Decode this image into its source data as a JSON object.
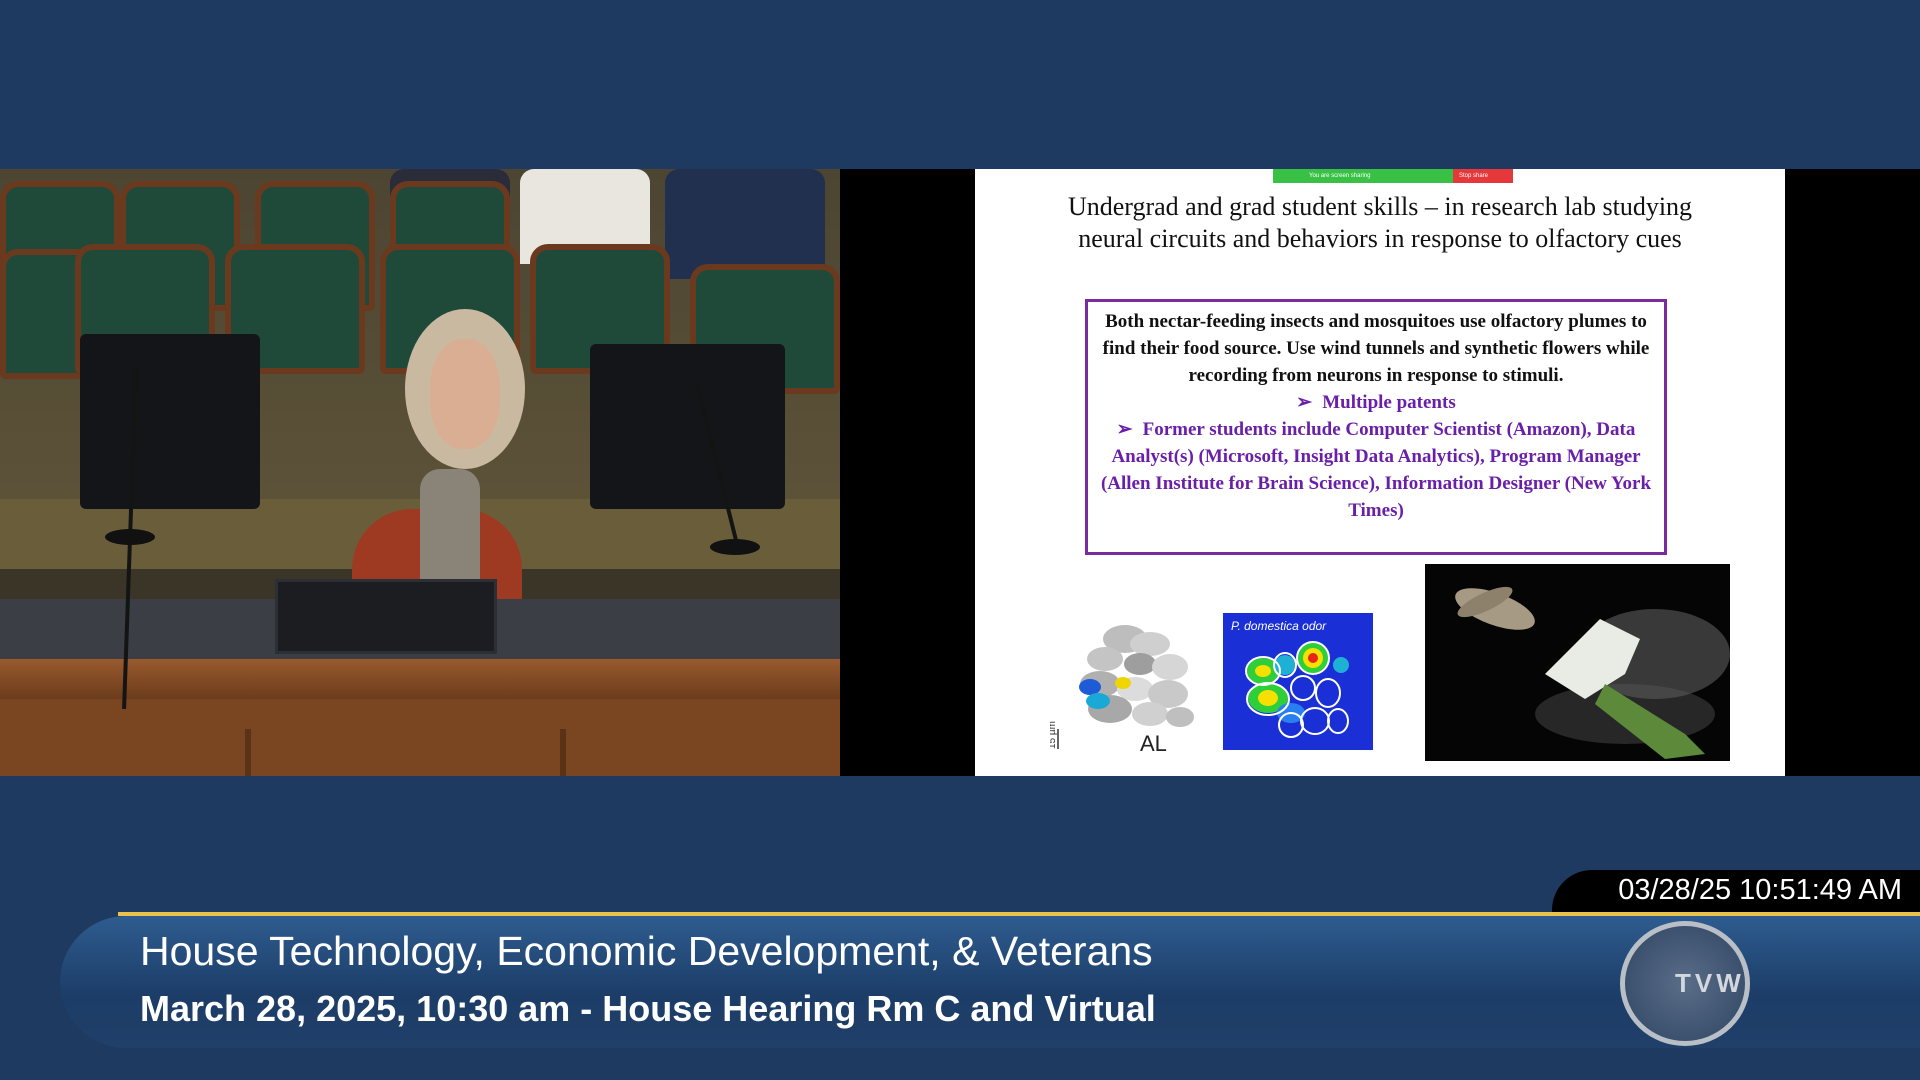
{
  "screen_share": {
    "status_text": "You are screen sharing",
    "stop_label": "Stop share"
  },
  "slide": {
    "title": "Undergrad and grad student skills – in research lab studying neural circuits and behaviors in response to olfactory cues",
    "body": "Both nectar-feeding insects and mosquitoes use olfactory plumes to find their food source. Use wind tunnels and synthetic flowers while recording from neurons in response to stimuli.",
    "bullet_arrow": "➢",
    "bullet_1": "Multiple patents",
    "bullet_2": "Former students include Computer Scientist (Amazon), Data Analyst(s) (Microsoft, Insight Data Analytics), Program Manager (Allen Institute for Brain Science), Information Designer (New York Times)",
    "fig_al_label": "AL",
    "fig_scale_label": "15 µm",
    "fig_heatmap_label": "P. domestica odor"
  },
  "broadcast": {
    "timestamp": "03/28/25 10:51:49 AM",
    "title": "House Technology, Economic Development, & Veterans",
    "subtitle": "March 28, 2025, 10:30 am - House Hearing Rm C and Virtual",
    "logo_text": "TVW"
  },
  "colors": {
    "background": "#1e3a60",
    "accent_gold": "#e8c24a",
    "slide_border": "#7a2c9e",
    "slide_bullet": "#6a1fa8"
  }
}
